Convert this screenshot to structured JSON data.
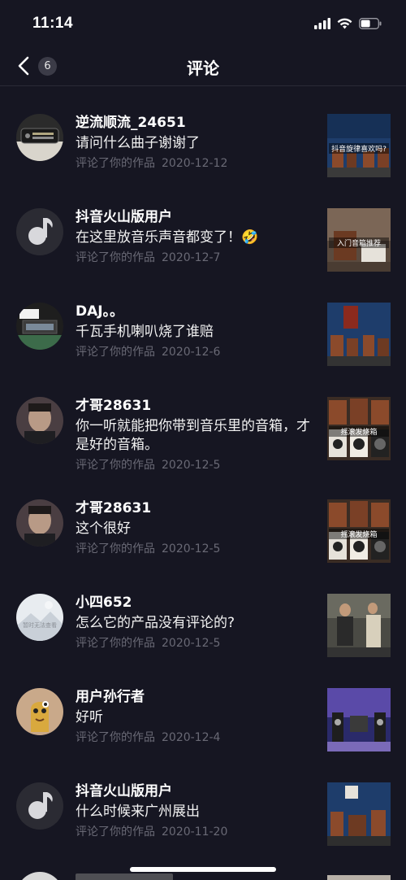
{
  "status_bar": {
    "time": "11:14"
  },
  "nav": {
    "badge_count": "6",
    "title": "评论"
  },
  "items": [
    {
      "username": "逆流顺流_24651",
      "comment": "请问什么曲子谢谢了",
      "action": "评论了你的作品",
      "date": "2020-12-12",
      "thumb_caption": "抖音旋律喜欢吗?"
    },
    {
      "username": "抖音火山版用户",
      "comment": "在这里放音乐声音都变了！🤣",
      "action": "评论了你的作品",
      "date": "2020-12-7",
      "thumb_caption": "入门音箱推荐"
    },
    {
      "username": "DAJ。。",
      "comment": "千瓦手机喇叭烧了谁赔",
      "action": "评论了你的作品",
      "date": "2020-12-6",
      "thumb_caption": ""
    },
    {
      "username": "才哥28631",
      "comment": "你一听就能把你带到音乐里的音箱，才是好的音箱。",
      "action": "评论了你的作品",
      "date": "2020-12-5",
      "thumb_caption": "摇滚发烧箱"
    },
    {
      "username": "才哥28631",
      "comment": "这个很好",
      "action": "评论了你的作品",
      "date": "2020-12-5",
      "thumb_caption": "摇滚发烧箱"
    },
    {
      "username": "小四652",
      "comment": "怎么它的产品没有评论的?",
      "action": "评论了你的作品",
      "date": "2020-12-5",
      "thumb_caption": ""
    },
    {
      "username": "用户孙行者",
      "comment": "好听",
      "action": "评论了你的作品",
      "date": "2020-12-4",
      "thumb_caption": ""
    },
    {
      "username": "抖音火山版用户",
      "comment": "什么时候来广州展出",
      "action": "评论了你的作品",
      "date": "2020-11-20",
      "thumb_caption": ""
    }
  ],
  "avatar_labels": {
    "xiaosi": "暂时无法查看"
  },
  "colors": {
    "background": "#161622",
    "meta_text": "#696975",
    "badge_bg": "#3b3b47"
  }
}
